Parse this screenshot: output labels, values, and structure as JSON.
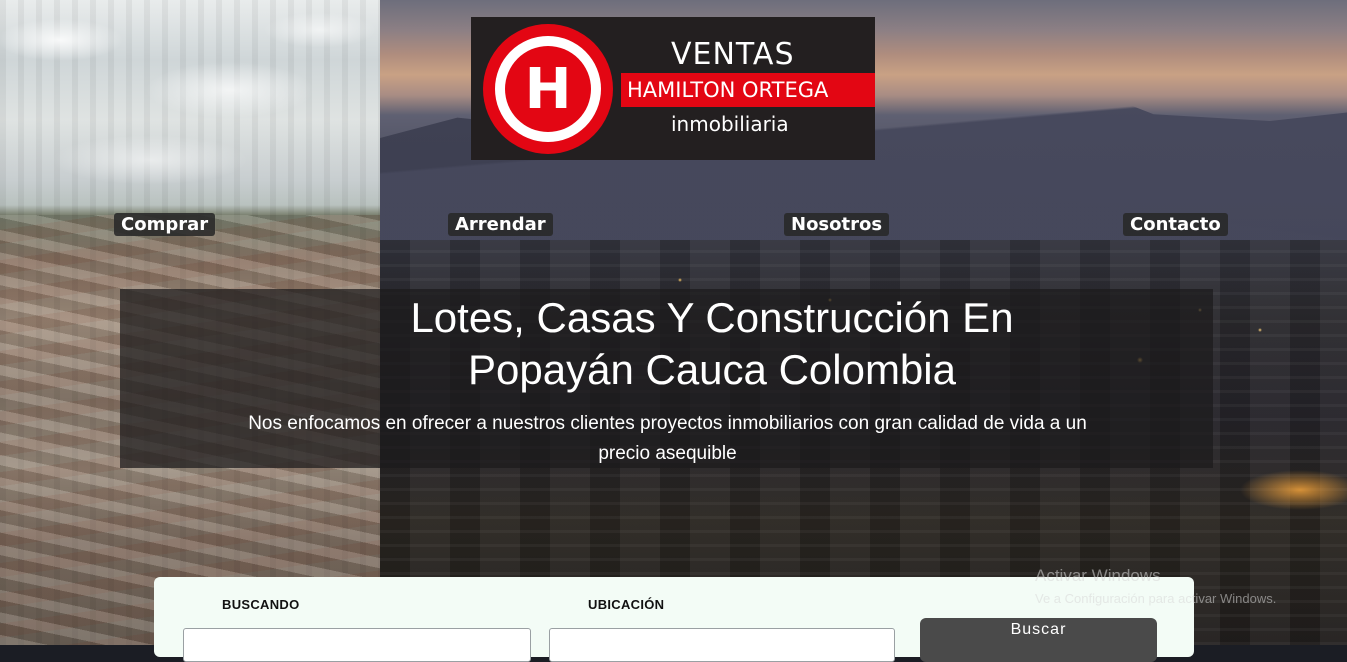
{
  "logo": {
    "line1": "VENTAS",
    "line2": "HAMILTON ORTEGA",
    "line3": "inmobiliaria",
    "mark": "H",
    "colors": {
      "red": "#e30613",
      "dark": "#231f20"
    }
  },
  "nav": {
    "items": [
      {
        "label": "Comprar"
      },
      {
        "label": "Arrendar"
      },
      {
        "label": "Nosotros"
      },
      {
        "label": "Contacto"
      }
    ]
  },
  "hero": {
    "title_line1": "Lotes, Casas Y Construcción En",
    "title_line2": "Popayán Cauca Colombia",
    "subtitle": "Nos enfocamos en ofrecer a nuestros clientes proyectos inmobiliarios con gran calidad de vida a un precio asequible"
  },
  "search": {
    "buscando_label": "BUSCANDO",
    "ubicacion_label": "UBICACIÓN",
    "buscando_value": "",
    "ubicacion_value": "",
    "button_label": "Buscar"
  },
  "watermark": {
    "title": "Activar Windows",
    "subtitle": "Ve a Configuración para activar Windows."
  }
}
